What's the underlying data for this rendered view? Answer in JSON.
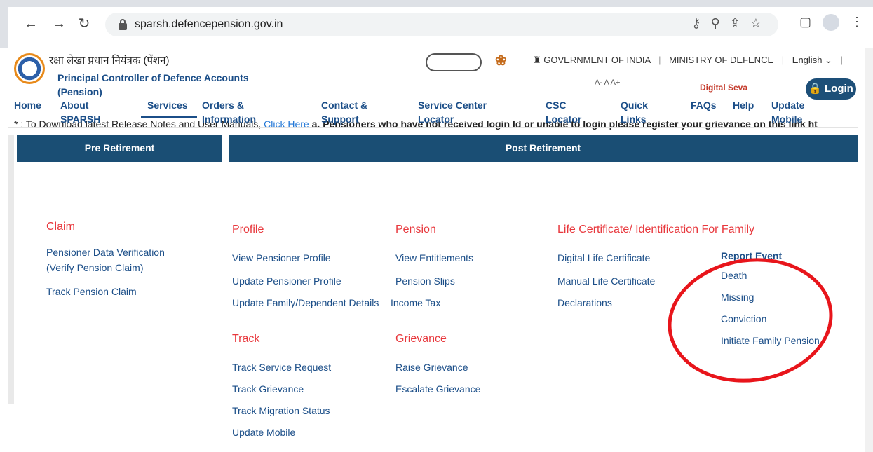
{
  "browser": {
    "url": "sparsh.defencepension.gov.in"
  },
  "header": {
    "org_hindi": "रक्षा लेखा प्रधान नियंत्रक (पेंशन)",
    "org_english": "Principal Controller of Defence Accounts (Pension)",
    "gov": "GOVERNMENT OF INDIA",
    "ministry": "MINISTRY OF DEFENCE",
    "language": "English",
    "font_size": "A- A A+",
    "digital_seva": "Digital Seva",
    "login": "Login"
  },
  "notice": {
    "prefix": "* : To Download latest Release Notes and User Manuals, ",
    "link": "Click Here",
    "text": " a. Pensioners who have not received login Id or unable to login please register your grievance on this link ht"
  },
  "nav": [
    {
      "label": "Home"
    },
    {
      "label": "About SPARSH"
    },
    {
      "label": "Services"
    },
    {
      "label": "Orders & Information"
    },
    {
      "label": "Contact & Support"
    },
    {
      "label": "Service Center Locator"
    },
    {
      "label": "CSC Locator"
    },
    {
      "label": "Quick Links"
    },
    {
      "label": "FAQs"
    },
    {
      "label": "Help"
    },
    {
      "label": "Update Mobile"
    }
  ],
  "panels": {
    "pre_retirement": "Pre Retirement",
    "post_retirement": "Post Retirement"
  },
  "claim": {
    "title": "Claim",
    "items": [
      "Pensioner Data Verification (Verify Pension Claim)",
      "Track Pension Claim"
    ]
  },
  "profile": {
    "title": "Profile",
    "items": [
      "View Pensioner Profile",
      "Update Pensioner Profile",
      "Update Family/Dependent Details"
    ]
  },
  "pension": {
    "title": "Pension",
    "items": [
      "View Entitlements",
      "Pension Slips",
      "Income Tax"
    ]
  },
  "life_certificate": {
    "title": "Life Certificate/ Identification For Family",
    "items": [
      "Digital Life Certificate",
      "Manual Life Certificate",
      "Declarations"
    ]
  },
  "report_event": {
    "title": "Report Event",
    "items": [
      "Death",
      "Missing",
      "Conviction",
      "Initiate Family Pension"
    ]
  },
  "track": {
    "title": "Track",
    "items": [
      "Track Service Request",
      "Track Grievance",
      "Track Migration Status",
      "Update Mobile"
    ]
  },
  "grievance": {
    "title": "Grievance",
    "items": [
      "Raise Grievance",
      "Escalate Grievance"
    ]
  },
  "colors": {
    "brand_blue": "#1a4e74",
    "link_blue": "#1b4e88",
    "section_red": "#e8383d",
    "circle_red": "#e8151b"
  }
}
